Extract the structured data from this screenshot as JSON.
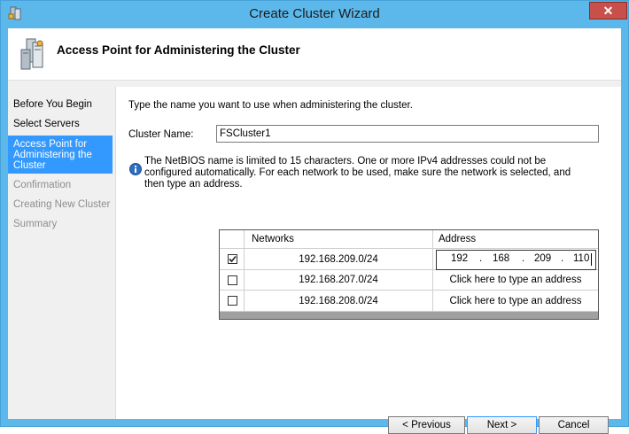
{
  "window": {
    "title": "Create Cluster Wizard",
    "close_glyph": "✕"
  },
  "header": {
    "title": "Access Point for Administering the Cluster",
    "icon": "server-cluster-icon"
  },
  "nav": {
    "items": [
      {
        "label": "Before You Begin",
        "state": "normal"
      },
      {
        "label": "Select Servers",
        "state": "normal"
      },
      {
        "label": "Access Point for Administering the Cluster",
        "state": "selected"
      },
      {
        "label": "Confirmation",
        "state": "disabled"
      },
      {
        "label": "Creating New Cluster",
        "state": "disabled"
      },
      {
        "label": "Summary",
        "state": "disabled"
      }
    ]
  },
  "main": {
    "prompt": "Type the name you want to use when administering the cluster.",
    "cluster_name_label": "Cluster Name:",
    "cluster_name_value": "FSCluster1",
    "info_text": "The NetBIOS name is limited to 15 characters.  One or more IPv4 addresses could not be configured automatically.  For each network to be used, make sure the network is selected, and then type an address.",
    "info_icon": "info-icon",
    "grid": {
      "columns": [
        "",
        "Networks",
        "Address"
      ],
      "rows": [
        {
          "checked": true,
          "network": "192.168.209.0/24",
          "address": [
            "192",
            "168",
            "209",
            "110"
          ],
          "editing": true
        },
        {
          "checked": false,
          "network": "192.168.207.0/24",
          "address": "Click here to type an address",
          "editing": false
        },
        {
          "checked": false,
          "network": "192.168.208.0/24",
          "address": "Click here to type an address",
          "editing": false
        }
      ]
    }
  },
  "buttons": {
    "previous": "< Previous",
    "next": "Next >",
    "cancel": "Cancel"
  },
  "colors": {
    "titlebar": "#5cb8ea",
    "selected": "#3399ff",
    "close": "#c7504b"
  }
}
